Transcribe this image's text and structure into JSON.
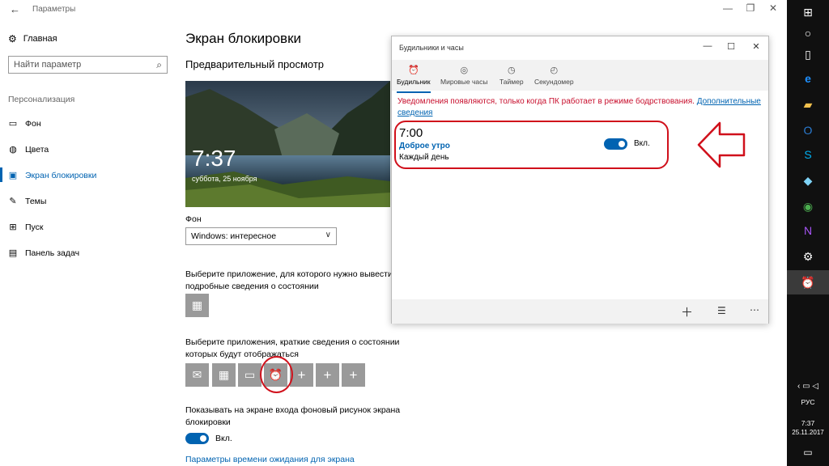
{
  "settings": {
    "window_title": "Параметры",
    "home_label": "Главная",
    "search_placeholder": "Найти параметр",
    "section_label": "Персонализация",
    "nav": [
      {
        "label": "Фон"
      },
      {
        "label": "Цвета"
      },
      {
        "label": "Экран блокировки"
      },
      {
        "label": "Темы"
      },
      {
        "label": "Пуск"
      },
      {
        "label": "Панель задач"
      }
    ],
    "page_title": "Экран блокировки",
    "preview_title": "Предварительный просмотр",
    "preview_time": "7:37",
    "preview_date": "суббота, 25 ноября",
    "background_label": "Фон",
    "background_value": "Windows: интересное",
    "detailed_status_text": "Выберите приложение, для которого нужно вывести подробные сведения о состоянии",
    "quick_status_text": "Выберите приложения, краткие сведения о состоянии которых будут отображаться",
    "signin_bg_text": "Показывать на экране входа фоновый рисунок экрана блокировки",
    "toggle_label": "Вкл.",
    "timeout_link": "Параметры времени ожидания для экрана"
  },
  "alarms": {
    "window_title": "Будильники и часы",
    "tabs": [
      {
        "label": "Будильник"
      },
      {
        "label": "Мировые часы"
      },
      {
        "label": "Таймер"
      },
      {
        "label": "Секундомер"
      }
    ],
    "notice_text": "Уведомления появляются, только когда ПК работает в режиме бодрствования.",
    "notice_link": "Дополнительные сведения",
    "alarm": {
      "time": "7:00",
      "name": "Доброе утро",
      "repeat": "Каждый день",
      "toggle_label": "Вкл."
    }
  },
  "taskbar": {
    "lang": "РУС",
    "time": "7:37",
    "date": "25.11.2017"
  },
  "colors": {
    "accent": "#0063b1",
    "annotation_red": "#d0101b",
    "taskbar_bg": "#101010"
  }
}
